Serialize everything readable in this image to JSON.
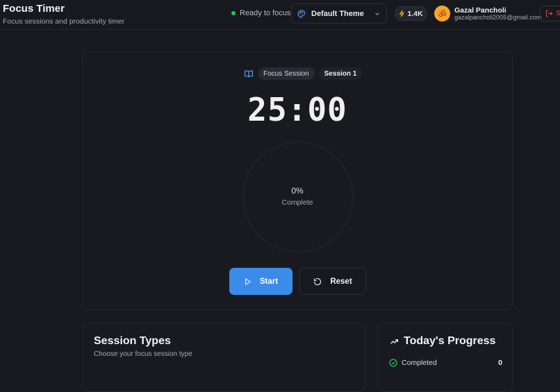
{
  "app": {
    "title": "Focus Timer",
    "subtitle": "Focus sessions and productivity timer"
  },
  "header": {
    "status_text": "Ready to focus",
    "status_color": "#22c55e",
    "theme_label": "Default Theme",
    "stars_count": "1.4K",
    "avatar_glyph": "ॐ",
    "user_name": "Gazal Pancholi",
    "user_email": "gazalpancholi2005@gmail.com",
    "logout_label": "S"
  },
  "timer": {
    "session_type": "Focus Session",
    "session_number": "Session 1",
    "time": "25:00",
    "progress_percent": 0,
    "progress_label": "0%",
    "progress_caption": "Complete",
    "start_label": "Start",
    "reset_label": "Reset",
    "accent_color": "#3b8bea"
  },
  "session_types": {
    "title": "Session Types",
    "subtitle": "Choose your focus session type"
  },
  "todays_progress": {
    "title": "Today's Progress",
    "rows": [
      {
        "label": "Completed",
        "value": "0"
      }
    ]
  }
}
